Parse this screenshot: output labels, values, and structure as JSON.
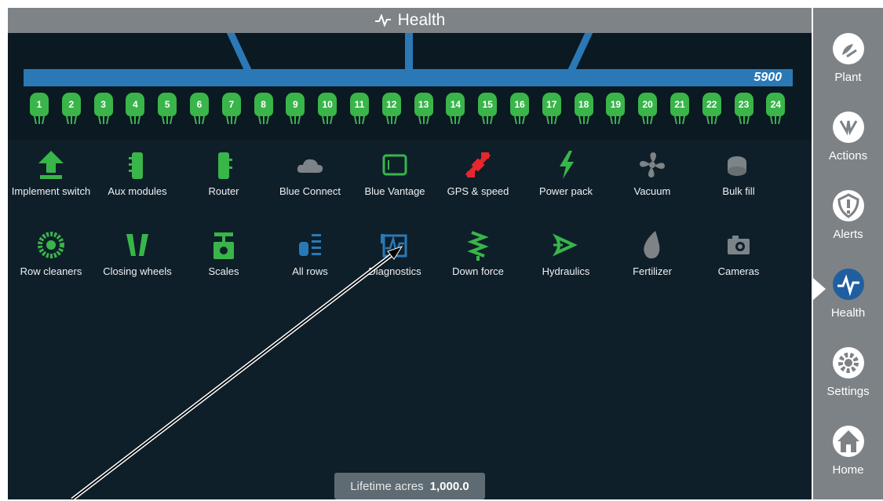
{
  "title": "Health",
  "implement": {
    "model": "5900",
    "rows": [
      "1",
      "2",
      "3",
      "4",
      "5",
      "6",
      "7",
      "8",
      "9",
      "10",
      "11",
      "12",
      "13",
      "14",
      "15",
      "16",
      "17",
      "18",
      "19",
      "20",
      "21",
      "22",
      "23",
      "24"
    ]
  },
  "tiles_row1": [
    {
      "label": "Implement switch",
      "icon": "arrow-up-icon"
    },
    {
      "label": "Aux modules",
      "icon": "module-icon"
    },
    {
      "label": "Router",
      "icon": "router-icon"
    },
    {
      "label": "Blue Connect",
      "icon": "cloud-icon"
    },
    {
      "label": "Blue Vantage",
      "icon": "tablet-icon"
    },
    {
      "label": "GPS & speed",
      "icon": "satellite-icon"
    },
    {
      "label": "Power pack",
      "icon": "lightning-icon"
    },
    {
      "label": "Vacuum",
      "icon": "fan-icon"
    },
    {
      "label": "Bulk fill",
      "icon": "bulk-fill-icon"
    }
  ],
  "tiles_row2": [
    {
      "label": "Row cleaners",
      "icon": "row-cleaner-icon"
    },
    {
      "label": "Closing wheels",
      "icon": "closing-wheels-icon"
    },
    {
      "label": "Scales",
      "icon": "scale-icon"
    },
    {
      "label": "All rows",
      "icon": "all-rows-icon"
    },
    {
      "label": "Diagnostics",
      "icon": "diagnostics-icon"
    },
    {
      "label": "Down force",
      "icon": "spring-icon"
    },
    {
      "label": "Hydraulics",
      "icon": "hydraulics-icon"
    },
    {
      "label": "Fertilizer",
      "icon": "drop-icon"
    },
    {
      "label": "Cameras",
      "icon": "camera-icon"
    }
  ],
  "footer": {
    "lifetime_label": "Lifetime acres",
    "lifetime_value": "1,000.0"
  },
  "nav": [
    {
      "label": "Plant",
      "icon": "plant-icon"
    },
    {
      "label": "Actions",
      "icon": "actions-icon"
    },
    {
      "label": "Alerts",
      "icon": "alert-shield-icon"
    },
    {
      "label": "Health",
      "icon": "health-icon",
      "active": true
    },
    {
      "label": "Settings",
      "icon": "gear-icon"
    },
    {
      "label": "Home",
      "icon": "home-icon"
    }
  ],
  "colors": {
    "accent": "#2a79b6",
    "row_green": "#39b54a",
    "background": "#0e1f2a",
    "gps_red": "#e8262b"
  }
}
